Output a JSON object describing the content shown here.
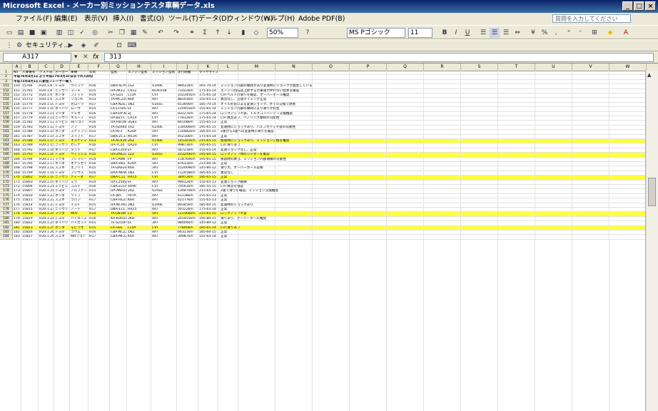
{
  "window": {
    "title": "Microsoft Excel - メーカー別ミッションテスタ車輌データ.xls",
    "controls": [
      "_",
      "□",
      "×"
    ]
  },
  "menu": {
    "items": [
      "ファイル(F)",
      "編集(E)",
      "表示(V)",
      "挿入(I)",
      "書式(O)",
      "ツール(T)",
      "データ(D)",
      "ウィンドウ(W)",
      "ヘルプ(H)",
      "Adobe PDF(B)"
    ],
    "help_placeholder": "質問を入力してください"
  },
  "toolbar": {
    "zoom": "50%",
    "font_name": "MS Pゴシック",
    "font_size": "11",
    "bold": "B",
    "italic": "I",
    "underline": "U",
    "security_label": "セキュリティ..."
  },
  "formula_bar": {
    "name_box": "A317",
    "fx": "fx",
    "value": "313"
  },
  "sheet": {
    "columns": [
      "A",
      "B",
      "C",
      "D",
      "E",
      "F",
      "G",
      "H",
      "I",
      "J",
      "K",
      "L",
      "M",
      "N",
      "O",
      "P",
      "Q",
      "R",
      "S",
      "T",
      "U",
      "V",
      "W"
    ],
    "header_row": {
      "num": "1",
      "cells": [
        "No",
        "入庫番号",
        "テスト日",
        "メーカー",
        "車種",
        "年式",
        "型式",
        "エンジン型式",
        "ミッション型式",
        "走行距離",
        "タイヤサイズ"
      ]
    },
    "notes": [
      {
        "num": "2",
        "text": "平成26年4月1日より平成27年3月31日までの入庫分"
      },
      {
        "num": "3",
        "text": "平成21年4月1日に新型プレーヤー導入"
      }
    ],
    "rows": [
      {
        "num": "151",
        "cells": [
          "150",
          "15764",
          "H20.1.8",
          "トヨタ",
          "ヴィッツ",
          "H16",
          "DBA-SCP10",
          "1SZ",
          "U340E",
          "98431km",
          "165-70-14"
        ],
        "note": "ミッション内部の摩耗があり変速時にショックが発生している"
      },
      {
        "num": "152",
        "cells": [
          "151",
          "15765",
          "H20.1.8",
          "ニッサン",
          "マーチ",
          "H15",
          "UA-AK12",
          "CR12",
          "RE4F03B",
          "71022km",
          "175-65-14"
        ],
        "note": "エンジン回転は上昇するが車速が伴わない症状を確認"
      },
      {
        "num": "153",
        "cells": [
          "152",
          "15772",
          "H20.1.9",
          "ホンダ",
          "フィット",
          "H14",
          "LA-GD1",
          "L13A",
          "CVT",
          "102345km",
          "175-65-14"
        ],
        "note": "CVTベルトの滑りを確認、オーバーホール推奨"
      },
      {
        "num": "154",
        "cells": [
          "153",
          "15773",
          "H20.1.9",
          "スズキ",
          "ワゴンR",
          "H13",
          "TA-MC22S",
          "K6A",
          "4AT",
          "88103km",
          "155-65-13"
        ],
        "note": "異音なし、変速タイミング正常"
      },
      {
        "num": "155",
        "cells": [
          "154",
          "15776",
          "H20.1.10",
          "トヨタ",
          "カローラ",
          "H17",
          "CBA-NZE121",
          "1NZ",
          "U341E",
          "65340km",
          "185-70-14"
        ],
        "note": "オイル劣化による変速ショック、オイル交換で改善"
      },
      {
        "num": "156",
        "cells": [
          "155",
          "15777",
          "H20.1.10",
          "ダイハツ",
          "ムーヴ",
          "H15",
          "LA-L150S",
          "EF",
          "4AT",
          "120455km",
          "155-65-14"
        ],
        "note": "ミッション内部の摩耗により滑りが発生"
      },
      {
        "num": "157",
        "cells": [
          "156",
          "15778",
          "H20.1.11",
          "マツダ",
          "デミオ",
          "H16",
          "CBA-DY3W",
          "ZJ",
          "4AT",
          "93227km",
          "175-65-14"
        ],
        "note": "ロックアップ不良、トルクコンバーター交換推奨"
      },
      {
        "num": "158",
        "cells": [
          "157",
          "15779",
          "H20.1.11",
          "ニッサン",
          "キューブ",
          "H15",
          "UA-BZ11",
          "CR14",
          "CVT",
          "77812km",
          "175-65-14"
        ],
        "note": "CVT異音あり、ベアリング摩耗の可能性"
      },
      {
        "num": "159",
        "cells": [
          "158",
          "15782",
          "H20.1.12",
          "ミツビシ",
          "ekワゴン",
          "H16",
          "UA-H81W",
          "3G83",
          "4AT",
          "66108km",
          "155-65-13"
        ],
        "note": "正常"
      },
      {
        "num": "160",
        "cells": [
          "159",
          "15783",
          "H20.1.12",
          "トヨタ",
          "ノア",
          "H14",
          "TA-AZR60G",
          "1AZ",
          "U240E",
          "130566km",
          "195-65-15"
        ],
        "note": "変速時にショックあり、バルブボディ不良の可能性"
      },
      {
        "num": "161",
        "cells": [
          "160",
          "15786",
          "H20.1.14",
          "ホンダ",
          "ステップワゴン",
          "H15",
          "LA-RF3",
          "K20A",
          "5AT",
          "110482km",
          "195-65-15"
        ],
        "note": "2速から3速への変速時に滑りを確認"
      },
      {
        "num": "162",
        "cells": [
          "161",
          "15787",
          "H20.1.14",
          "スズキ",
          "スイフト",
          "H17",
          "DBA-ZC11S",
          "M13A",
          "4AT",
          "45210km",
          "175-65-14"
        ],
        "note": "正常"
      },
      {
        "num": "163",
        "cells": [
          "162",
          "15788",
          "H20.1.15",
          "トヨタ",
          "エスティマ",
          "H13",
          "TA-ACR30W",
          "2AZ",
          "U140E",
          "145301km",
          "215-65-15"
        ],
        "note": "加速時にショックあり、ミッション交換を推奨",
        "highlight": true
      },
      {
        "num": "164",
        "cells": [
          "163",
          "15789",
          "H20.1.15",
          "ニッサン",
          "セレナ",
          "H16",
          "UA-TC24",
          "QR20",
          "CVT",
          "99873km",
          "195-65-15"
        ],
        "note": "CVT滑りあり"
      },
      {
        "num": "165",
        "cells": [
          "164",
          "15792",
          "H20.1.16",
          "ダイハツ",
          "タント",
          "H17",
          "CBA-L350S",
          "EF",
          "4AT",
          "56721km",
          "155-65-14"
        ],
        "note": "変速ショックなし、正常"
      },
      {
        "num": "166",
        "cells": [
          "165",
          "15793",
          "H20.1.16",
          "トヨタ",
          "ウィッシュ",
          "H15",
          "UA-ZNE10G",
          "1ZZ",
          "U341E",
          "103244km",
          "195-60-15"
        ],
        "note": "ロックアップ時のジャダーを確認",
        "highlight": true
      },
      {
        "num": "167",
        "cells": [
          "166",
          "15794",
          "H20.1.17",
          "マツダ",
          "プレマシー",
          "H14",
          "TA-CP8W",
          "FP",
          "4AT",
          "118760km",
          "195-65-15"
        ],
        "note": "後退時の異音、ミッション内部損傷の可能性"
      },
      {
        "num": "168",
        "cells": [
          "167",
          "15795",
          "H20.1.17",
          "ホンダ",
          "オデッセイ",
          "H16",
          "DBA-RB1",
          "K24A",
          "5AT",
          "87631km",
          "215-60-16"
        ],
        "note": "正常"
      },
      {
        "num": "169",
        "cells": [
          "168",
          "15798",
          "H20.1.18",
          "スズキ",
          "エブリイ",
          "H15",
          "TA-DA62V",
          "K6A",
          "3AT",
          "152009km",
          "145-80-12"
        ],
        "note": "滑り大、オーバーホール必要"
      },
      {
        "num": "170",
        "cells": [
          "169",
          "15799",
          "H20.1.18",
          "トヨタ",
          "プリウス",
          "H16",
          "DAA-NHW20",
          "1NZ",
          "CVT",
          "112458km",
          "185-65-15"
        ],
        "note": "異常なし"
      },
      {
        "num": "171",
        "cells": [
          "170",
          "15802",
          "H20.1.19",
          "ニッサン",
          "ティーダ",
          "H17",
          "DBA-C11",
          "HR15",
          "CVT",
          "38972km",
          "185-65-15"
        ],
        "note": "正常",
        "highlight": true
      },
      {
        "num": "172",
        "cells": [
          "171",
          "15803",
          "H20.1.19",
          "ダイハツ",
          "ミラ",
          "H14",
          "UA-L250S",
          "EF",
          "4AT",
          "99012km",
          "155-65-13"
        ],
        "note": "変速ショック軽微"
      },
      {
        "num": "173",
        "cells": [
          "172",
          "15806",
          "H20.1.21",
          "ミツビシ",
          "コルト",
          "H16",
          "CBA-Z21A",
          "4A90",
          "CVT",
          "70561km",
          "185-55-15"
        ],
        "note": "CVT異音を確認"
      },
      {
        "num": "174",
        "cells": [
          "173",
          "15807",
          "H20.1.21",
          "トヨタ",
          "アルファード",
          "H15",
          "UA-ANH10W",
          "2AZ",
          "U241E",
          "134870km",
          "215-65-16"
        ],
        "note": "2速で滑りを確認、ミッション交換推奨"
      },
      {
        "num": "175",
        "cells": [
          "174",
          "15810",
          "H20.1.22",
          "ホンダ",
          "ライフ",
          "H16",
          "LA-JB5",
          "P07A",
          "4AT",
          "61238km",
          "155-65-13"
        ],
        "note": "正常"
      },
      {
        "num": "176",
        "cells": [
          "175",
          "15811",
          "H20.1.22",
          "スズキ",
          "ラパン",
          "H17",
          "CBA-HE21S",
          "K6A",
          "4AT",
          "42177km",
          "155-65-13"
        ],
        "note": "正常"
      },
      {
        "num": "177",
        "cells": [
          "176",
          "15814",
          "H20.1.23",
          "トヨタ",
          "イスト",
          "H15",
          "UA-NCP61",
          "2NZ",
          "U340E",
          "89345km",
          "185-60-15"
        ],
        "note": "変速時のショックあり"
      },
      {
        "num": "178",
        "cells": [
          "177",
          "15815",
          "H20.1.23",
          "ニッサン",
          "ノート",
          "H17",
          "DBA-E11",
          "HR15",
          "4AT",
          "50122km",
          "175-65-14"
        ],
        "note": "正常"
      },
      {
        "num": "179",
        "cells": [
          "178",
          "15818",
          "H20.1.24",
          "マツダ",
          "MPV",
          "H14",
          "TA-LW3W",
          "L3",
          "5AT",
          "121566km",
          "215-65-15"
        ],
        "note": "ロックアップ不良",
        "highlight": true
      },
      {
        "num": "180",
        "cells": [
          "179",
          "15819",
          "H20.1.24",
          "トヨタ",
          "ハイエース",
          "H16",
          "KR-KDH200V",
          "2KD",
          "4AT",
          "201455km",
          "195-80-15"
        ],
        "note": "滑りあり、オーバーホール推奨"
      },
      {
        "num": "181",
        "cells": [
          "180",
          "15822",
          "H20.1.25",
          "ダイハツ",
          "ハイゼット",
          "H15",
          "TE-S210P",
          "EF",
          "3AT",
          "98004km",
          "145-80-12"
        ],
        "note": "正常"
      },
      {
        "num": "182",
        "cells": [
          "181",
          "15823",
          "H20.1.25",
          "ホンダ",
          "モビリオ",
          "H15",
          "LA-GB1",
          "L15A",
          "CVT",
          "77840km",
          "185-65-14"
        ],
        "note": "CVT滑りあり",
        "highlight": true
      },
      {
        "num": "183",
        "cells": [
          "182",
          "15826",
          "H20.1.26",
          "トヨタ",
          "ラウム",
          "H16",
          "CBA-NCZ20",
          "1NZ",
          "4AT",
          "66311km",
          "185-60-15"
        ],
        "note": "正常"
      },
      {
        "num": "184",
        "cells": [
          "183",
          "15827",
          "H20.1.26",
          "スズキ",
          "MRワゴン",
          "H17",
          "CBA-MF22S",
          "K6A",
          "4AT",
          "39987km",
          "155-65-14"
        ],
        "note": "正常"
      }
    ]
  }
}
